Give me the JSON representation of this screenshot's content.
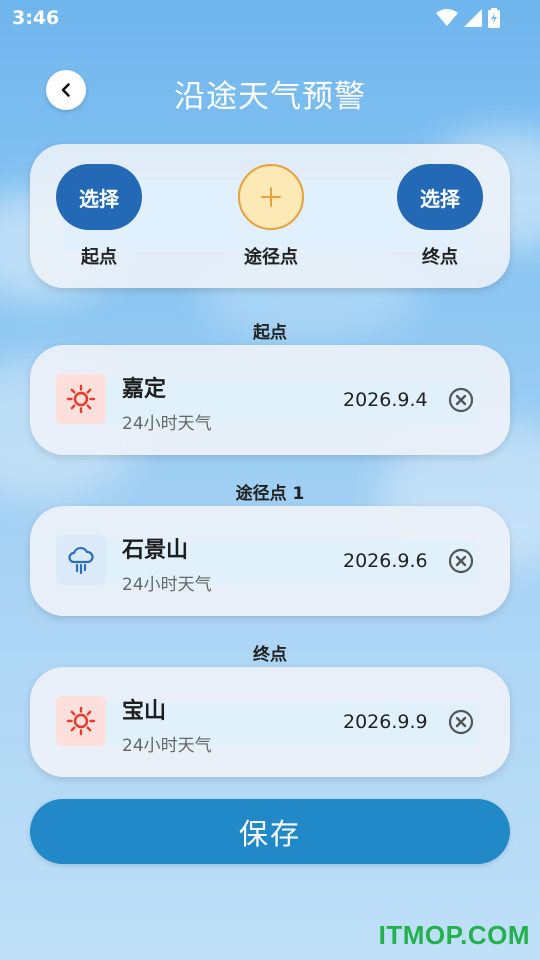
{
  "status_bar": {
    "time": "3:46"
  },
  "header": {
    "title": "沿途天气预警",
    "back_icon": "chevron-left-icon"
  },
  "route": {
    "start_button": "选择",
    "end_button": "选择",
    "start_label": "起点",
    "waypoint_label": "途径点",
    "end_label": "终点",
    "add_icon": "plus-icon"
  },
  "points": [
    {
      "section": "起点",
      "name": "嘉定",
      "sub": "24小时天气",
      "date": "2026.9.4",
      "icon": "sun-icon"
    },
    {
      "section": "途径点 1",
      "name": "石景山",
      "sub": "24小时天气",
      "date": "2026.9.6",
      "icon": "cloud-rain-icon"
    },
    {
      "section": "终点",
      "name": "宝山",
      "sub": "24小时天气",
      "date": "2026.9.9",
      "icon": "sun-icon"
    }
  ],
  "save_button": "保存",
  "watermark": "ITMOP.COM",
  "colors": {
    "primary": "#2469b5",
    "save": "#2289c9",
    "accent": "#e6a23c",
    "sun": "#e53a2d",
    "rain": "#2c6fb5"
  }
}
